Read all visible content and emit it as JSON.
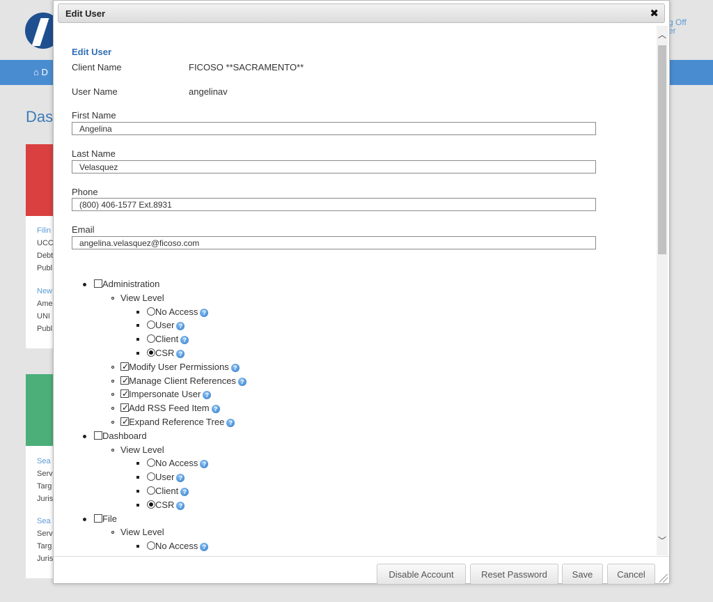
{
  "background": {
    "top_links": [
      "g Off",
      "er"
    ],
    "nav_home": "⌂ D",
    "page_title": "Das",
    "card1_snippets": [
      "Filin",
      "UCC",
      "Debt",
      "Publ",
      "New",
      "Ame",
      "UNI",
      "Publ"
    ],
    "card2_snippets": [
      "Sea",
      "Serv",
      "Targ",
      "Juris",
      "Sea",
      "Serv",
      "Targ",
      "Juris"
    ]
  },
  "modal": {
    "title": "Edit User",
    "close": "✖",
    "section_title": "Edit User",
    "client_name_label": "Client Name",
    "client_name_value": "FICOSO **SACRAMENTO**",
    "user_name_label": "User Name",
    "user_name_value": "angelinav",
    "first_name_label": "First Name",
    "first_name_value": "Angelina",
    "last_name_label": "Last Name",
    "last_name_value": "Velasquez",
    "phone_label": "Phone",
    "phone_value": "(800) 406-1577 Ext.8931",
    "email_label": "Email",
    "email_value": "angelina.velasquez@ficoso.com"
  },
  "permissions": [
    {
      "level": 1,
      "type": "checkbox",
      "checked": false,
      "label": "Administration",
      "help": false
    },
    {
      "level": 2,
      "type": "text",
      "label": "View Level"
    },
    {
      "level": 3,
      "type": "radio",
      "checked": false,
      "label": "No Access",
      "help": true
    },
    {
      "level": 3,
      "type": "radio",
      "checked": false,
      "label": "User",
      "help": true
    },
    {
      "level": 3,
      "type": "radio",
      "checked": false,
      "label": "Client",
      "help": true
    },
    {
      "level": 3,
      "type": "radio",
      "checked": true,
      "label": "CSR",
      "help": true
    },
    {
      "level": 2,
      "type": "checkbox",
      "checked": true,
      "label": "Modify User Permissions",
      "help": true
    },
    {
      "level": 2,
      "type": "checkbox",
      "checked": true,
      "label": "Manage Client References",
      "help": true
    },
    {
      "level": 2,
      "type": "checkbox",
      "checked": true,
      "label": "Impersonate User",
      "help": true
    },
    {
      "level": 2,
      "type": "checkbox",
      "checked": true,
      "label": "Add RSS Feed Item",
      "help": true
    },
    {
      "level": 2,
      "type": "checkbox",
      "checked": true,
      "label": "Expand Reference Tree",
      "help": true
    },
    {
      "level": 1,
      "type": "checkbox",
      "checked": false,
      "label": "Dashboard",
      "help": false
    },
    {
      "level": 2,
      "type": "text",
      "label": "View Level"
    },
    {
      "level": 3,
      "type": "radio",
      "checked": false,
      "label": "No Access",
      "help": true
    },
    {
      "level": 3,
      "type": "radio",
      "checked": false,
      "label": "User",
      "help": true
    },
    {
      "level": 3,
      "type": "radio",
      "checked": false,
      "label": "Client",
      "help": true
    },
    {
      "level": 3,
      "type": "radio",
      "checked": true,
      "label": "CSR",
      "help": true
    },
    {
      "level": 1,
      "type": "checkbox",
      "checked": false,
      "label": "File",
      "help": false
    },
    {
      "level": 2,
      "type": "text",
      "label": "View Level"
    },
    {
      "level": 3,
      "type": "radio",
      "checked": false,
      "label": "No Access",
      "help": true
    }
  ],
  "buttons": {
    "disable": "Disable Account",
    "reset": "Reset Password",
    "save": "Save",
    "cancel": "Cancel"
  },
  "colors": {
    "accent": "#2f6db4",
    "nav": "#4a8cd0",
    "card_red": "#d9403f",
    "card_green": "#4caf7a"
  }
}
